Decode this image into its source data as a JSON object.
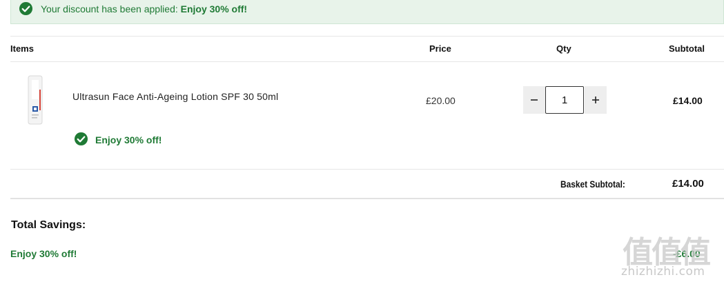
{
  "banner": {
    "message_prefix": "Your discount has been applied: ",
    "message_highlight": "Enjoy 30% off!"
  },
  "table": {
    "headers": {
      "items": "Items",
      "price": "Price",
      "qty": "Qty",
      "subtotal": "Subtotal"
    },
    "rows": [
      {
        "name": "Ultrasun Face Anti-Ageing Lotion SPF 30 50ml",
        "offer": "Enjoy 30% off!",
        "price": "£20.00",
        "quantity": "1",
        "subtotal": "£14.00"
      }
    ]
  },
  "basket": {
    "label": "Basket Subtotal:",
    "value": "£14.00"
  },
  "savings": {
    "title": "Total Savings:",
    "items": [
      {
        "label": "Enjoy 30% off!",
        "value": "-£6.00"
      }
    ]
  },
  "watermark": {
    "chars": "值值值",
    "domain": "zhizhizhi.com"
  },
  "colors": {
    "success_green": "#1f7a35",
    "banner_bg": "#e8f3ea"
  }
}
